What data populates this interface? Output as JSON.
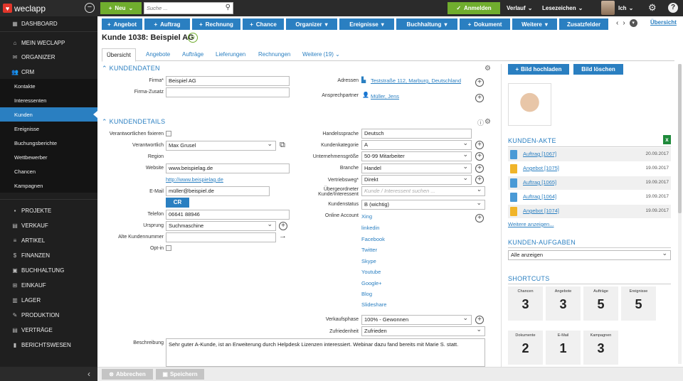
{
  "app": {
    "name": "weclapp"
  },
  "topbar": {
    "new_label": "Neu",
    "search_placeholder": "Suche ...",
    "anmelden_label": "Anmelden",
    "verlauf_label": "Verlauf",
    "lesezeichen_label": "Lesezeichen",
    "user_label": "Ich"
  },
  "sidebar": {
    "items": [
      {
        "label": "DASHBOARD",
        "icon": "dashboard-icon"
      },
      {
        "label": "MEIN WECLAPP",
        "icon": "home-icon"
      },
      {
        "label": "ORGANIZER",
        "icon": "mail-icon"
      },
      {
        "label": "CRM",
        "icon": "people-icon"
      },
      {
        "label": "Kontakte"
      },
      {
        "label": "Interessenten"
      },
      {
        "label": "Kunden"
      },
      {
        "label": "Ereignisse"
      },
      {
        "label": "Buchungsberichte"
      },
      {
        "label": "Wettbewerber"
      },
      {
        "label": "Chancen"
      },
      {
        "label": "Kampagnen"
      },
      {
        "label": "PROJEKTE",
        "icon": "briefcase-icon"
      },
      {
        "label": "VERKAUF",
        "icon": "document-icon"
      },
      {
        "label": "ARTIKEL",
        "icon": "list-icon"
      },
      {
        "label": "FINANZEN",
        "icon": "dollar-icon"
      },
      {
        "label": "BUCHHALTUNG",
        "icon": "book-icon"
      },
      {
        "label": "EINKAUF",
        "icon": "cart-icon"
      },
      {
        "label": "LAGER",
        "icon": "warehouse-icon"
      },
      {
        "label": "PRODUKTION",
        "icon": "wrench-icon"
      },
      {
        "label": "VERTRÄGE",
        "icon": "contract-icon"
      },
      {
        "label": "BERICHTSWESEN",
        "icon": "chart-icon"
      }
    ],
    "collapse_icon": "chevron-left-icon"
  },
  "actions": [
    "Angebot",
    "Auftrag",
    "Rechnung",
    "Chance",
    "Organizer",
    "Ereignisse",
    "Buchhaltung",
    "Dokument",
    "Weitere",
    "Zusatzfelder"
  ],
  "header": {
    "title": "Kunde 1038: Beispiel AG",
    "overview_link": "Übersicht"
  },
  "tabs": [
    "Übersicht",
    "Angebote",
    "Aufträge",
    "Lieferungen",
    "Rechnungen",
    "Weitere (19)"
  ],
  "kundendaten": {
    "heading": "KUNDENDATEN",
    "firma_label": "Firma*",
    "firma_value": "Beispiel AG",
    "firma_zusatz_label": "Firma-Zusatz",
    "firma_zusatz_value": "",
    "adressen_label": "Adressen",
    "adresse_value": "Teststraße 112, Marburg, Deutschland",
    "ansprechpartner_label": "Ansprechpartner",
    "ansprechpartner_value": "Müller, Jens"
  },
  "kundendetails": {
    "heading": "KUNDENDETAILS",
    "verantwortlichen_fixieren_label": "Verantwortlichen fixieren",
    "verantwortlich_label": "Verantwortlich",
    "verantwortlich_value": "Max Grusel",
    "region_label": "Region",
    "website_label": "Website",
    "website_value": "www.beispielag.de",
    "website_link": "http://www.beispielag.de",
    "email_label": "E-Mail",
    "email_value": "müller@beispiel.de",
    "cr_label": "CR",
    "telefon_label": "Telefon",
    "telefon_value": "06641 88946",
    "ursprung_label": "Ursprung",
    "ursprung_value": "Suchmaschine",
    "alte_kundennummer_label": "Alte Kundennummer",
    "alte_kundennummer_value": "",
    "optin_label": "Opt-in",
    "handelssprache_label": "Handelssprache",
    "handelssprache_value": "Deutsch",
    "kundenkategorie_label": "Kundenkategorie",
    "kundenkategorie_value": "A",
    "unternehmensgroesse_label": "Unternehmensgröße",
    "unternehmensgroesse_value": "50-99 Mitarbeiter",
    "branche_label": "Branche",
    "branche_value": "Handel",
    "vertriebsweg_label": "Vertriebsweg*",
    "vertriebsweg_value": "Direkt",
    "uebergeordneter_label_1": "Übergeordneter",
    "uebergeordneter_label_2": "Kunde/Interessent",
    "uebergeordneter_placeholder": "Kunde / Interessent suchen ...",
    "kundenstatus_label": "Kundenstatus",
    "kundenstatus_value": "B (wichtig)",
    "online_account_label": "Online Account",
    "online_accounts": [
      "Xing",
      "linkedin",
      "Facebook",
      "Twitter",
      "Skype",
      "Youtube",
      "Google+",
      "Blog",
      "Slideshare"
    ],
    "verkaufsphase_label": "Verkaufsphase",
    "verkaufsphase_value": "100% - Gewonnen",
    "zufriedenheit_label": "Zufriedenheit",
    "zufriedenheit_value": "Zufrieden",
    "beschreibung_label": "Beschreibung",
    "beschreibung_value": "Sehr guter A-Kunde, ist an Erweiterung durch Helpdesk Lizenzen interessiert. Webinar dazu fand bereits mit Marie S. statt."
  },
  "right": {
    "upload_label": "Bild hochladen",
    "delete_label": "Bild löschen",
    "akte_heading": "KUNDEN-AKTE",
    "akte": [
      {
        "label": "Auftrag [1067]",
        "date": "20.09.2017",
        "icon": "order-doc-icon",
        "color": "#4a9ad6"
      },
      {
        "label": "Angebot [1075]",
        "date": "19.09.2017",
        "icon": "offer-doc-icon",
        "color": "#f0b429"
      },
      {
        "label": "Auftrag [1065]",
        "date": "19.09.2017",
        "icon": "order-doc-icon",
        "color": "#4a9ad6"
      },
      {
        "label": "Auftrag [1064]",
        "date": "19.09.2017",
        "icon": "order-doc-icon",
        "color": "#4a9ad6"
      },
      {
        "label": "Angebot [1074]",
        "date": "19.09.2017",
        "icon": "offer-doc-icon",
        "color": "#f0b429"
      }
    ],
    "more_label": "Weitere anzeigen...",
    "aufgaben_heading": "KUNDEN-AUFGABEN",
    "aufgaben_filter": "Alle anzeigen",
    "shortcuts_heading": "SHORTCUTS",
    "shortcuts": [
      {
        "label": "Chancen",
        "count": "3"
      },
      {
        "label": "Angebote",
        "count": "3"
      },
      {
        "label": "Aufträge",
        "count": "5"
      },
      {
        "label": "Ereignisse",
        "count": "5"
      },
      {
        "label": "Dokumente",
        "count": "2"
      },
      {
        "label": "E-Mail",
        "count": "1"
      },
      {
        "label": "Kampagnen",
        "count": "3"
      }
    ]
  },
  "bottom": {
    "abbrechen_label": "Abbrechen",
    "speichern_label": "Speichern"
  },
  "colors": {
    "primary": "#2a7fc1",
    "green": "#70ad2e",
    "topbar": "#2b2b2b",
    "sidebar": "#1f1f1f"
  }
}
